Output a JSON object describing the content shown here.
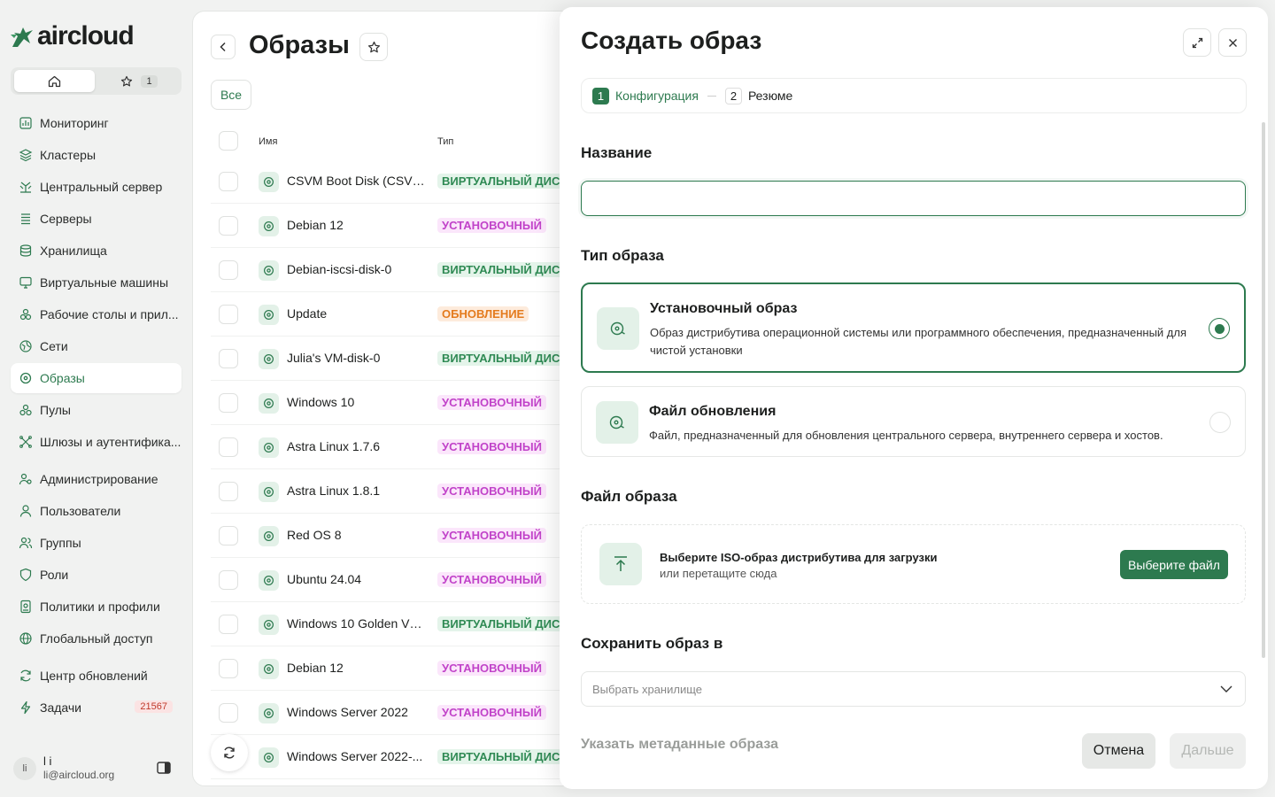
{
  "app": {
    "logo_text": "aircloud"
  },
  "switcher": {
    "favorites_count": "1"
  },
  "sidebar": {
    "items": [
      {
        "label": "Мониторинг"
      },
      {
        "label": "Кластеры"
      },
      {
        "label": "Центральный сервер"
      },
      {
        "label": "Серверы"
      },
      {
        "label": "Хранилища"
      },
      {
        "label": "Виртуальные машины"
      },
      {
        "label": "Рабочие столы и прил..."
      },
      {
        "label": "Сети"
      },
      {
        "label": "Образы"
      },
      {
        "label": "Пулы"
      },
      {
        "label": "Шлюзы и аутентифика..."
      },
      {
        "label": "Администрирование"
      },
      {
        "label": "Пользователи"
      },
      {
        "label": "Группы"
      },
      {
        "label": "Роли"
      },
      {
        "label": "Политики и профили"
      },
      {
        "label": "Глобальный доступ"
      },
      {
        "label": "Центр обновлений"
      },
      {
        "label": "Задачи",
        "badge": "21567"
      }
    ],
    "active_index": 8
  },
  "user": {
    "initials": "li",
    "name": "l i",
    "email": "li@aircloud.org"
  },
  "page": {
    "title": "Образы",
    "filter_all": "Все",
    "columns": {
      "name": "Имя",
      "type": "Тип"
    },
    "rows": [
      {
        "name": "CSVM Boot Disk (CSVM ...",
        "type": "ВИРТУАЛЬНЫЙ ДИСК",
        "kind": "vd"
      },
      {
        "name": "Debian 12",
        "type": "УСТАНОВОЧНЫЙ",
        "kind": "inst"
      },
      {
        "name": "Debian-iscsi-disk-0",
        "type": "ВИРТУАЛЬНЫЙ ДИСК",
        "kind": "vd"
      },
      {
        "name": "Update",
        "type": "ОБНОВЛЕНИЕ",
        "kind": "upd"
      },
      {
        "name": "Julia's VM-disk-0",
        "type": "ВИРТУАЛЬНЫЙ ДИСК",
        "kind": "vd"
      },
      {
        "name": "Windows 10",
        "type": "УСТАНОВОЧНЫЙ",
        "kind": "inst"
      },
      {
        "name": "Astra Linux 1.7.6",
        "type": "УСТАНОВОЧНЫЙ",
        "kind": "inst"
      },
      {
        "name": "Astra Linux 1.8.1",
        "type": "УСТАНОВОЧНЫЙ",
        "kind": "inst"
      },
      {
        "name": "Red OS 8",
        "type": "УСТАНОВОЧНЫЙ",
        "kind": "inst"
      },
      {
        "name": "Ubuntu 24.04",
        "type": "УСТАНОВОЧНЫЙ",
        "kind": "inst"
      },
      {
        "name": "Windows 10 Golden VM...",
        "type": "ВИРТУАЛЬНЫЙ ДИСК",
        "kind": "vd"
      },
      {
        "name": "Debian 12",
        "type": "УСТАНОВОЧНЫЙ",
        "kind": "inst"
      },
      {
        "name": "Windows Server 2022",
        "type": "УСТАНОВОЧНЫЙ",
        "kind": "inst"
      },
      {
        "name": "Windows Server 2022-...",
        "type": "ВИРТУАЛЬНЫЙ ДИСК",
        "kind": "vd"
      }
    ]
  },
  "drawer": {
    "title": "Создать образ",
    "steps": [
      {
        "num": "1",
        "label": "Конфигурация",
        "active": true
      },
      {
        "num": "2",
        "label": "Резюме",
        "active": false
      }
    ],
    "name_label": "Название",
    "name_value": "",
    "type_label": "Тип образа",
    "options": [
      {
        "title": "Установочный образ",
        "desc": "Образ дистрибутива операционной системы или программного обеспечения, предназначенный для чистой установки",
        "selected": true
      },
      {
        "title": "Файл обновления",
        "desc": "Файл, предназначенный для обновления центрального сервера, внутреннего сервера и хостов.",
        "selected": false
      }
    ],
    "file_label": "Файл образа",
    "upload_title": "Выберите ISO-образ дистрибутива для загрузки",
    "upload_sub": "или перетащите сюда",
    "upload_button": "Выберите файл",
    "save_label": "Сохранить образ в",
    "storage_placeholder": "Выбрать хранилище",
    "metadata_link": "Указать метаданные образа",
    "cancel": "Отмена",
    "next": "Дальше"
  },
  "colors": {
    "accent": "#2d7a4f",
    "install_badge": "#c143c9",
    "vdisk_badge": "#2f8a54",
    "update_badge": "#e47b1e",
    "error_badge": "#c0392b"
  }
}
